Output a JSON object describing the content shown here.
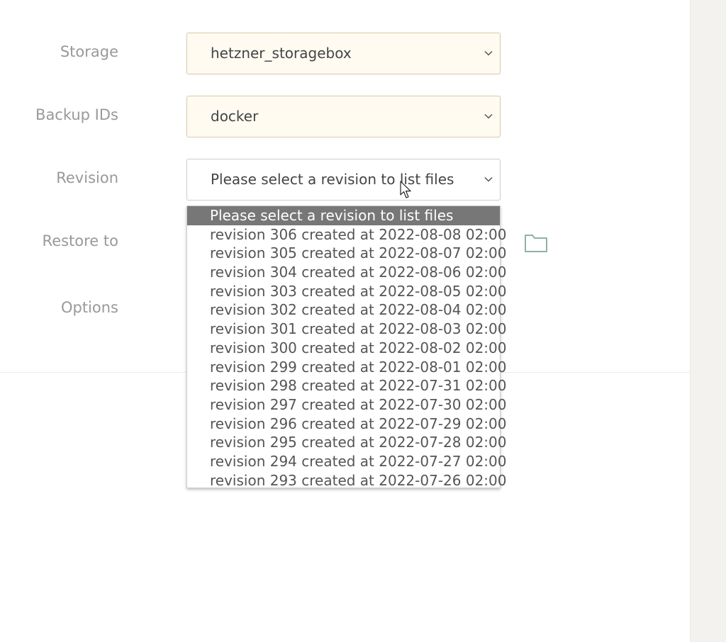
{
  "form": {
    "storage": {
      "label": "Storage",
      "value": "hetzner_storagebox"
    },
    "backup_ids": {
      "label": "Backup IDs",
      "value": "docker"
    },
    "revision": {
      "label": "Revision",
      "value": "Please select a revision to list files"
    },
    "restore_to": {
      "label": "Restore to"
    },
    "options": {
      "label": "Options"
    }
  },
  "revision_dropdown": {
    "options": [
      "Please select a revision to list files",
      "revision 306 created at 2022-08-08 02:00",
      "revision 305 created at 2022-08-07 02:00",
      "revision 304 created at 2022-08-06 02:00",
      "revision 303 created at 2022-08-05 02:00",
      "revision 302 created at 2022-08-04 02:00",
      "revision 301 created at 2022-08-03 02:00",
      "revision 300 created at 2022-08-02 02:00",
      "revision 299 created at 2022-08-01 02:00",
      "revision 298 created at 2022-07-31 02:00",
      "revision 297 created at 2022-07-30 02:00",
      "revision 296 created at 2022-07-29 02:00",
      "revision 295 created at 2022-07-28 02:00",
      "revision 294 created at 2022-07-27 02:00",
      "revision 293 created at 2022-07-26 02:00"
    ],
    "selected_index": 0
  },
  "icons": {
    "chevron": "chevron-down-icon",
    "folder": "folder-icon",
    "cursor": "mouse-pointer-icon"
  },
  "colors": {
    "select_bg": "#fffbf1",
    "select_border": "#d7c9a4",
    "selected_option_bg": "#777777",
    "folder_icon": "#8fb29f",
    "label_text": "#999999"
  }
}
